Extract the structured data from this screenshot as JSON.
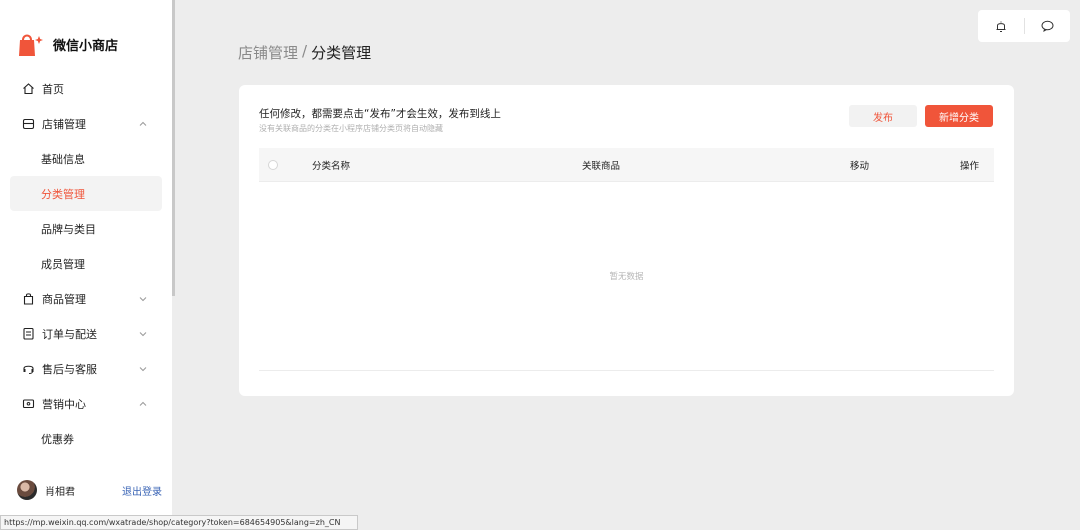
{
  "app": {
    "name": "微信小商店"
  },
  "sidebar": {
    "items": [
      {
        "label": "首页",
        "icon": "home-icon"
      },
      {
        "label": "店铺管理",
        "icon": "store-icon",
        "expanded": true,
        "children": [
          "基础信息",
          "分类管理",
          "品牌与类目",
          "成员管理"
        ],
        "active_child": "分类管理"
      },
      {
        "label": "商品管理",
        "icon": "bag-icon",
        "expanded": false
      },
      {
        "label": "订单与配送",
        "icon": "order-icon",
        "expanded": false
      },
      {
        "label": "售后与客服",
        "icon": "headset-icon",
        "expanded": false
      },
      {
        "label": "营销中心",
        "icon": "coupon-icon",
        "expanded": true,
        "children": [
          "优惠券"
        ]
      }
    ],
    "sub_store": {
      "basic": "基础信息",
      "category": "分类管理",
      "brand": "品牌与类目",
      "members": "成员管理"
    },
    "sub_marketing": {
      "coupon": "优惠券"
    }
  },
  "user": {
    "name": "肖相君",
    "logout": "退出登录"
  },
  "statusbar": {
    "url": "https://mp.weixin.qq.com/wxatrade/shop/category?token=684654905&lang=zh_CN"
  },
  "breadcrumb": {
    "parent": "店铺管理",
    "separator": "/",
    "current": "分类管理"
  },
  "card": {
    "notice_title": "任何修改，都需要点击“发布”才会生效，发布到线上",
    "notice_sub": "没有关联商品的分类在小程序店铺分类页将自动隐藏",
    "publish_label": "发布",
    "add_label": "新增分类"
  },
  "table": {
    "columns": [
      "分类名称",
      "关联商品",
      "移动",
      "操作"
    ],
    "empty_text": "暂无数据"
  },
  "colors": {
    "accent": "#f0553a",
    "link": "#3a64b5",
    "background": "#ededed"
  }
}
